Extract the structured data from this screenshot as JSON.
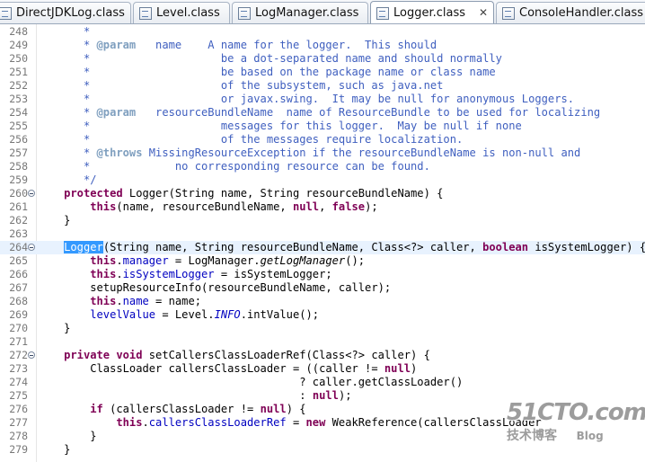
{
  "tabs": [
    {
      "label": "DirectJDKLog.class",
      "active": false,
      "icon": "class-file-icon"
    },
    {
      "label": "Level.class",
      "active": false,
      "icon": "class-file-icon"
    },
    {
      "label": "LogManager.class",
      "active": false,
      "icon": "class-file-icon"
    },
    {
      "label": "Logger.class",
      "active": true,
      "icon": "class-file-icon",
      "close": "✕"
    },
    {
      "label": "ConsoleHandler.class",
      "active": false,
      "icon": "class-file-icon"
    }
  ],
  "editor": {
    "highlighted_line": "264",
    "selected_word": "Logger",
    "lines": [
      {
        "n": "248",
        "fold": false,
        "segs": [
          [
            "c",
            "       *"
          ]
        ]
      },
      {
        "n": "249",
        "fold": false,
        "segs": [
          [
            "c",
            "       * "
          ],
          [
            "tag",
            "@param"
          ],
          [
            "c",
            "   name    A name for the logger.  This should"
          ]
        ]
      },
      {
        "n": "250",
        "fold": false,
        "segs": [
          [
            "c",
            "       *                    be a dot-separated name and should normally"
          ]
        ]
      },
      {
        "n": "251",
        "fold": false,
        "segs": [
          [
            "c",
            "       *                    be based on the package name or class name"
          ]
        ]
      },
      {
        "n": "252",
        "fold": false,
        "segs": [
          [
            "c",
            "       *                    of the subsystem, such as java.net"
          ]
        ]
      },
      {
        "n": "253",
        "fold": false,
        "segs": [
          [
            "c",
            "       *                    or javax.swing.  It may be null for anonymous Loggers."
          ]
        ]
      },
      {
        "n": "254",
        "fold": false,
        "segs": [
          [
            "c",
            "       * "
          ],
          [
            "tag",
            "@param"
          ],
          [
            "c",
            "   resourceBundleName  name of ResourceBundle to be used for localizing"
          ]
        ]
      },
      {
        "n": "255",
        "fold": false,
        "segs": [
          [
            "c",
            "       *                    messages for this logger.  May be null if none"
          ]
        ]
      },
      {
        "n": "256",
        "fold": false,
        "segs": [
          [
            "c",
            "       *                    of the messages require localization."
          ]
        ]
      },
      {
        "n": "257",
        "fold": false,
        "segs": [
          [
            "c",
            "       * "
          ],
          [
            "tag",
            "@throws"
          ],
          [
            "c",
            " MissingResourceException if the resourceBundleName is non-null and"
          ]
        ]
      },
      {
        "n": "258",
        "fold": false,
        "segs": [
          [
            "c",
            "       *             no corresponding resource can be found."
          ]
        ]
      },
      {
        "n": "259",
        "fold": false,
        "segs": [
          [
            "c",
            "       */"
          ]
        ]
      },
      {
        "n": "260",
        "fold": true,
        "segs": [
          [
            "p",
            "    "
          ],
          [
            "k",
            "protected"
          ],
          [
            "p",
            " Logger(String name, String resourceBundleName) {"
          ]
        ]
      },
      {
        "n": "261",
        "fold": false,
        "segs": [
          [
            "p",
            "        "
          ],
          [
            "k",
            "this"
          ],
          [
            "p",
            "(name, resourceBundleName, "
          ],
          [
            "k",
            "null"
          ],
          [
            "p",
            ", "
          ],
          [
            "k",
            "false"
          ],
          [
            "p",
            ");"
          ]
        ]
      },
      {
        "n": "262",
        "fold": false,
        "segs": [
          [
            "p",
            "    }"
          ]
        ]
      },
      {
        "n": "263",
        "fold": false,
        "segs": [
          [
            "p",
            ""
          ]
        ]
      },
      {
        "n": "264",
        "fold": true,
        "segs": [
          [
            "p",
            "    "
          ],
          [
            "sel",
            "Logger"
          ],
          [
            "p",
            "(String name, String resourceBundleName, Class<?> caller, "
          ],
          [
            "k",
            "boolean"
          ],
          [
            "p",
            " isSystemLogger) {"
          ]
        ]
      },
      {
        "n": "265",
        "fold": false,
        "segs": [
          [
            "p",
            "        "
          ],
          [
            "k",
            "this"
          ],
          [
            "p",
            "."
          ],
          [
            "f",
            "manager"
          ],
          [
            "p",
            " = LogManager."
          ],
          [
            "it",
            "getLogManager"
          ],
          [
            "p",
            "();"
          ]
        ]
      },
      {
        "n": "266",
        "fold": false,
        "segs": [
          [
            "p",
            "        "
          ],
          [
            "k",
            "this"
          ],
          [
            "p",
            "."
          ],
          [
            "f",
            "isSystemLogger"
          ],
          [
            "p",
            " = isSystemLogger;"
          ]
        ]
      },
      {
        "n": "267",
        "fold": false,
        "segs": [
          [
            "p",
            "        setupResourceInfo(resourceBundleName, caller);"
          ]
        ]
      },
      {
        "n": "268",
        "fold": false,
        "segs": [
          [
            "p",
            "        "
          ],
          [
            "k",
            "this"
          ],
          [
            "p",
            "."
          ],
          [
            "f",
            "name"
          ],
          [
            "p",
            " = name;"
          ]
        ]
      },
      {
        "n": "269",
        "fold": false,
        "segs": [
          [
            "p",
            "        "
          ],
          [
            "f",
            "levelValue"
          ],
          [
            "p",
            " = Level."
          ],
          [
            "fi",
            "INFO"
          ],
          [
            "p",
            ".intValue();"
          ]
        ]
      },
      {
        "n": "270",
        "fold": false,
        "segs": [
          [
            "p",
            "    }"
          ]
        ]
      },
      {
        "n": "271",
        "fold": false,
        "segs": [
          [
            "p",
            ""
          ]
        ]
      },
      {
        "n": "272",
        "fold": true,
        "segs": [
          [
            "p",
            "    "
          ],
          [
            "k",
            "private"
          ],
          [
            "p",
            " "
          ],
          [
            "k",
            "void"
          ],
          [
            "p",
            " setCallersClassLoaderRef(Class<?> caller) {"
          ]
        ]
      },
      {
        "n": "273",
        "fold": false,
        "segs": [
          [
            "p",
            "        ClassLoader callersClassLoader = ((caller != "
          ],
          [
            "k",
            "null"
          ],
          [
            "p",
            ")"
          ]
        ]
      },
      {
        "n": "274",
        "fold": false,
        "segs": [
          [
            "p",
            "                                        ? caller.getClassLoader()"
          ]
        ]
      },
      {
        "n": "275",
        "fold": false,
        "segs": [
          [
            "p",
            "                                        : "
          ],
          [
            "k",
            "null"
          ],
          [
            "p",
            ");"
          ]
        ]
      },
      {
        "n": "276",
        "fold": false,
        "segs": [
          [
            "p",
            "        "
          ],
          [
            "k",
            "if"
          ],
          [
            "p",
            " (callersClassLoader != "
          ],
          [
            "k",
            "null"
          ],
          [
            "p",
            ") {"
          ]
        ]
      },
      {
        "n": "277",
        "fold": false,
        "segs": [
          [
            "p",
            "            "
          ],
          [
            "k",
            "this"
          ],
          [
            "p",
            "."
          ],
          [
            "f",
            "callersClassLoaderRef"
          ],
          [
            "p",
            " = "
          ],
          [
            "k",
            "new"
          ],
          [
            "p",
            " WeakReference(callersClassLoader"
          ]
        ]
      },
      {
        "n": "278",
        "fold": false,
        "segs": [
          [
            "p",
            "        }"
          ]
        ]
      },
      {
        "n": "279",
        "fold": false,
        "segs": [
          [
            "p",
            "    }"
          ]
        ]
      }
    ]
  },
  "watermark": {
    "big": "51CTO.com",
    "small": "技术博客",
    "blog": "Blog"
  }
}
